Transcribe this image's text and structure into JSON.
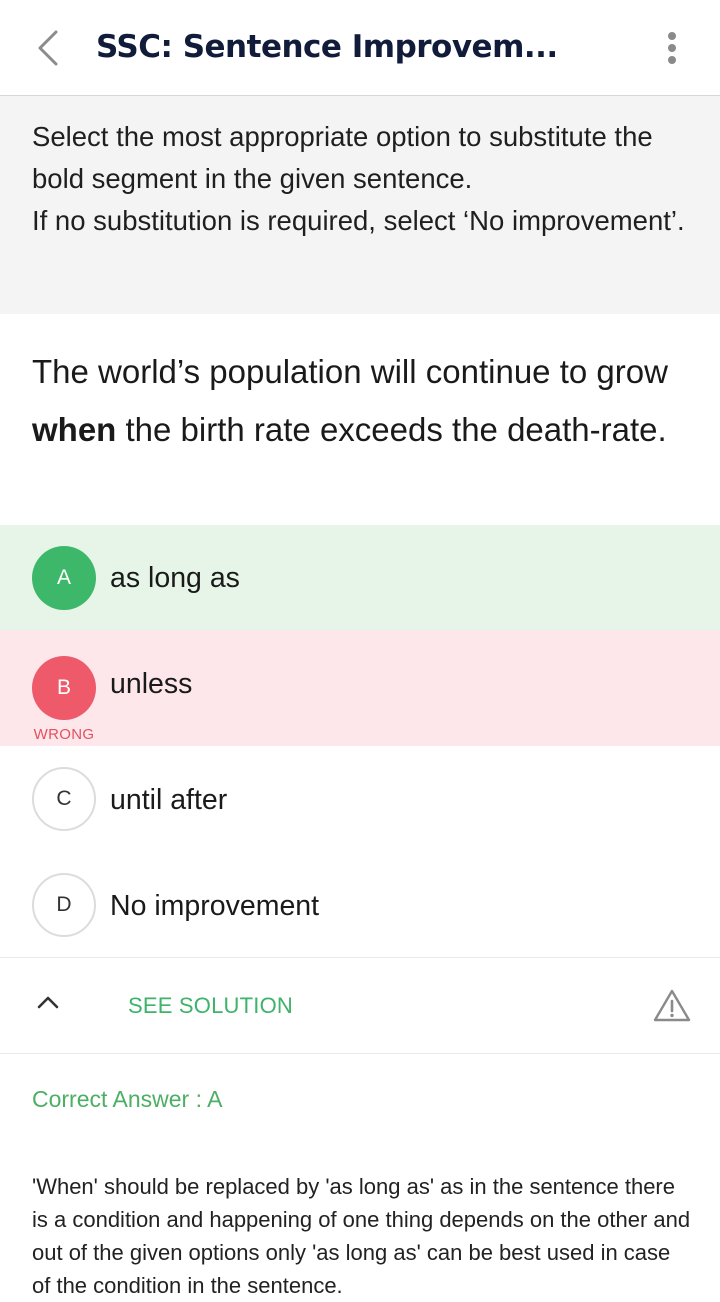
{
  "header": {
    "title": "SSC: Sentence Improvem...",
    "back_icon": "chevron-left-icon",
    "more_icon": "more-vertical-icon"
  },
  "instruction": {
    "line1": "Select the most appropriate option to substitute the bold segment in the given sentence.",
    "line2": "If no substitution is required, select ‘No improvement’."
  },
  "question": {
    "before": "The world’s population will continue to grow ",
    "bold": "when",
    "after": " the birth rate exceeds the death-rate."
  },
  "options": [
    {
      "letter": "A",
      "text": "as long as",
      "state": "correct"
    },
    {
      "letter": "B",
      "text": "unless",
      "state": "wrong",
      "tag": "WRONG"
    },
    {
      "letter": "C",
      "text": "until after",
      "state": "neutral"
    },
    {
      "letter": "D",
      "text": "No improvement",
      "state": "neutral"
    }
  ],
  "solution": {
    "toggle_label": "SEE SOLUTION",
    "toggle_icon": "chevron-up-icon",
    "report_icon": "warning-triangle-icon",
    "correct_answer": "Correct Answer : A",
    "explanation": "'When' should be replaced by 'as long as' as in the sentence there is a condition and happening of one thing depends on the other and out of the given options only 'as long as' can be best used in case of the condition in the sentence."
  },
  "colors": {
    "correct_bg": "#e6f5e7",
    "correct_badge": "#3db86a",
    "wrong_bg": "#fde7ea",
    "wrong_badge": "#ef5a6a",
    "accent_green": "#3eb36a",
    "title_color": "#111c3a"
  }
}
